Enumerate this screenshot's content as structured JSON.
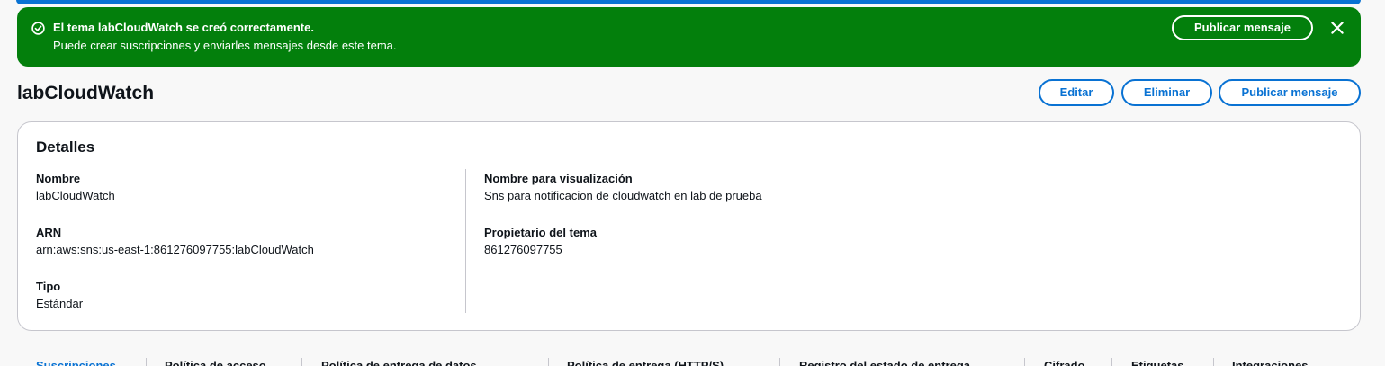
{
  "flash": {
    "title": "El tema labCloudWatch se creó correctamente.",
    "body": "Puede crear suscripciones y enviarles mensajes desde este tema.",
    "action_label": "Publicar mensaje",
    "icon": "check-circle-icon",
    "close_icon": "close-icon",
    "color": "#037f0c"
  },
  "header": {
    "title": "labCloudWatch",
    "edit_label": "Editar",
    "delete_label": "Eliminar",
    "publish_label": "Publicar mensaje"
  },
  "details": {
    "title": "Detalles",
    "name_label": "Nombre",
    "name_value": "labCloudWatch",
    "arn_label": "ARN",
    "arn_value": "arn:aws:sns:us-east-1:861276097755:labCloudWatch",
    "type_label": "Tipo",
    "type_value": "Estándar",
    "display_name_label": "Nombre para visualización",
    "display_name_value": "Sns para notificacion de cloudwatch en lab de prueba",
    "owner_label": "Propietario del tema",
    "owner_value": "861276097755"
  },
  "tabs": [
    {
      "label": "Suscripciones"
    },
    {
      "label": "Política de acceso"
    },
    {
      "label": "Política de entrega de datos"
    },
    {
      "label": "Política de entrega (HTTP/S)"
    },
    {
      "label": "Registro del estado de entrega"
    },
    {
      "label": "Cifrado"
    },
    {
      "label": "Etiquetas"
    },
    {
      "label": "Integraciones"
    }
  ],
  "colors": {
    "accent": "#0972d3",
    "success": "#037f0c",
    "border": "#c6c6cd"
  }
}
